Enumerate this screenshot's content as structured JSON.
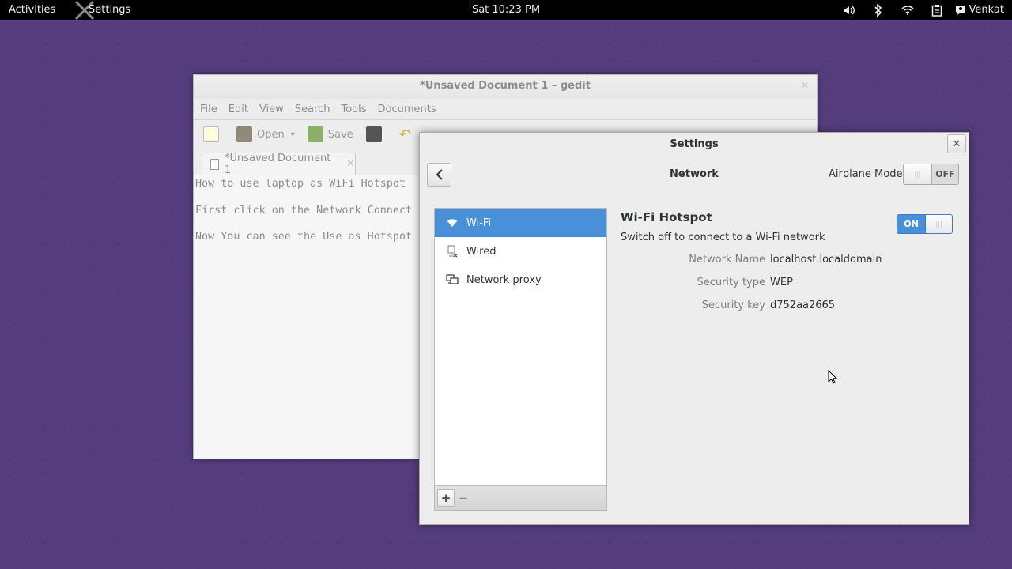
{
  "topbar": {
    "activities": "Activities",
    "app_menu": "Settings",
    "clock": "Sat 10:23 PM",
    "user": "Venkat",
    "tray_icons": [
      "volume-icon",
      "bluetooth-icon",
      "network-icon",
      "clipboard-icon",
      "user-icon"
    ]
  },
  "gedit": {
    "title": "*Unsaved Document 1 – gedit",
    "menu": [
      "File",
      "Edit",
      "View",
      "Search",
      "Tools",
      "Documents"
    ],
    "toolbar": {
      "open": "Open",
      "save": "Save"
    },
    "tab_label": "*Unsaved Document 1",
    "lines": [
      "How to use laptop as WiFi Hotspot",
      "First click on the Network Connect",
      "Now You can see the Use as Hotspot"
    ]
  },
  "settings": {
    "title": "Settings",
    "header_title": "Network",
    "airplane_label": "Airplane Mode",
    "airplane_state": "OFF",
    "list": [
      {
        "label": "Wi-Fi",
        "icon": "wifi-icon",
        "selected": true
      },
      {
        "label": "Wired",
        "icon": "wired-icon",
        "selected": false
      },
      {
        "label": "Network proxy",
        "icon": "network-proxy-icon",
        "selected": false
      }
    ],
    "add_symbol": "+",
    "remove_symbol": "−",
    "hotspot": {
      "title": "Wi-Fi Hotspot",
      "subtitle": "Switch off to connect to a Wi-Fi network",
      "switch_state": "ON",
      "fields": [
        {
          "key": "Network Name",
          "value": "localhost.localdomain"
        },
        {
          "key": "Security type",
          "value": "WEP"
        },
        {
          "key": "Security key",
          "value": "d752aa2665"
        }
      ]
    }
  },
  "colors": {
    "accent": "#4a90d9",
    "desktop": "#553d7d",
    "panel": "#000000"
  }
}
